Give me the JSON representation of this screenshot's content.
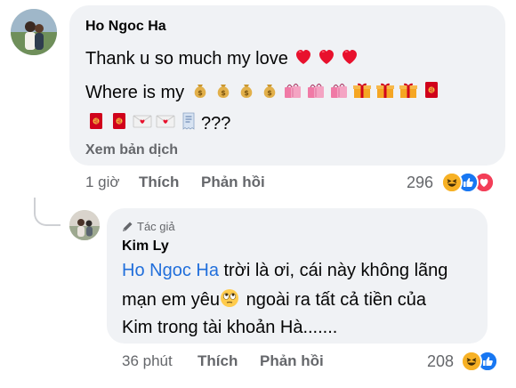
{
  "comment": {
    "author": "Ho Ngoc Ha",
    "line1": "Thank u so much my love",
    "line2_prefix": "Where is my",
    "line3_suffix": "???",
    "see_translation": "Xem bản dịch",
    "time": "1 giờ",
    "like": "Thích",
    "reply": "Phản hồi",
    "reaction_count": "296",
    "line1_emojis": [
      "red-heart",
      "red-heart",
      "red-heart"
    ],
    "line2_emojis": [
      "money-bag",
      "money-bag",
      "money-bag",
      "money-bag",
      "shopping-bags",
      "shopping-bags",
      "shopping-bags",
      "gift",
      "gift",
      "gift",
      "red-envelope"
    ],
    "line3_emojis": [
      "red-envelope",
      "red-envelope",
      "love-letter",
      "love-letter",
      "receipt"
    ]
  },
  "reply": {
    "badge": "Tác giả",
    "author": "Kim Ly",
    "mention": "Ho Ngoc Ha",
    "line1_rest": " trời là ơi, cái này không lãng",
    "line2_prefix": "mạn em yêu",
    "line2_suffix": " ngoài ra tất cả tiền của",
    "line3": "Kim trong tài khoản Hà.......",
    "time": "36 phút",
    "like": "Thích",
    "reply": "Phản hồi",
    "reaction_count": "208"
  },
  "colors": {
    "bubble": "#f0f2f5",
    "secondary_text": "#65676b",
    "mention": "#216fdb",
    "like_blue": "#1877f2",
    "love_red": "#f33e58",
    "haha_yellow": "#f7b125"
  }
}
